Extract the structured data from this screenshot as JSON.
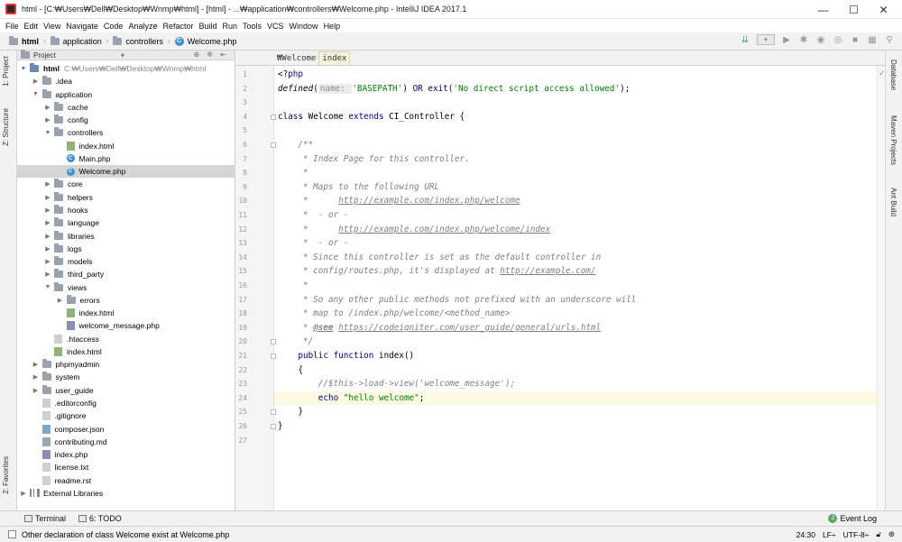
{
  "window": {
    "title": "html - [C:₩Users₩Dell₩Desktop₩Wnmp₩html] - [html] - ...₩application₩controllers₩Welcome.php - IntelliJ IDEA 2017.1",
    "minimize": "—",
    "maximize": "☐",
    "close": "✕"
  },
  "menu": [
    "File",
    "Edit",
    "View",
    "Navigate",
    "Code",
    "Analyze",
    "Refactor",
    "Build",
    "Run",
    "Tools",
    "VCS",
    "Window",
    "Help"
  ],
  "breadcrumb": [
    "html",
    "application",
    "controllers",
    "Welcome.php"
  ],
  "left_tabs": {
    "project": "1: Project",
    "structure": "Z: Structure",
    "favorites": "2: Favorites"
  },
  "right_tabs": {
    "database": "Database",
    "maven": "Maven Projects",
    "ant": "Ant Build"
  },
  "project_panel": {
    "title": "Project",
    "root_path": "C:₩Users₩Dell₩Desktop₩Wnmp₩html"
  },
  "tree": [
    {
      "label": "html",
      "type": "root",
      "depth": 0,
      "open": true
    },
    {
      "label": ".idea",
      "type": "dir",
      "depth": 1,
      "open": false
    },
    {
      "label": "application",
      "type": "dir",
      "depth": 1,
      "open": true
    },
    {
      "label": "cache",
      "type": "dir",
      "depth": 2,
      "open": false
    },
    {
      "label": "config",
      "type": "dir",
      "depth": 2,
      "open": false
    },
    {
      "label": "controllers",
      "type": "dir",
      "depth": 2,
      "open": true
    },
    {
      "label": "index.html",
      "type": "html",
      "depth": 3
    },
    {
      "label": "Main.php",
      "type": "class",
      "depth": 3
    },
    {
      "label": "Welcome.php",
      "type": "class",
      "depth": 3,
      "selected": true
    },
    {
      "label": "core",
      "type": "dir",
      "depth": 2,
      "open": false
    },
    {
      "label": "helpers",
      "type": "dir",
      "depth": 2,
      "open": false
    },
    {
      "label": "hooks",
      "type": "dir",
      "depth": 2,
      "open": false
    },
    {
      "label": "language",
      "type": "dir",
      "depth": 2,
      "open": false
    },
    {
      "label": "libraries",
      "type": "dir",
      "depth": 2,
      "open": false
    },
    {
      "label": "logs",
      "type": "dir",
      "depth": 2,
      "open": false
    },
    {
      "label": "models",
      "type": "dir",
      "depth": 2,
      "open": false
    },
    {
      "label": "third_party",
      "type": "dir",
      "depth": 2,
      "open": false
    },
    {
      "label": "views",
      "type": "dir",
      "depth": 2,
      "open": true
    },
    {
      "label": "errors",
      "type": "dir",
      "depth": 3,
      "open": false
    },
    {
      "label": "index.html",
      "type": "html",
      "depth": 3
    },
    {
      "label": "welcome_message.php",
      "type": "php",
      "depth": 3
    },
    {
      "label": ".htaccess",
      "type": "txt",
      "depth": 2
    },
    {
      "label": "index.html",
      "type": "html",
      "depth": 2
    },
    {
      "label": "phpmyadmin",
      "type": "dir",
      "depth": 1,
      "open": false
    },
    {
      "label": "system",
      "type": "dir",
      "depth": 1,
      "open": false
    },
    {
      "label": "user_guide",
      "type": "dir",
      "depth": 1,
      "open": false
    },
    {
      "label": ".editorconfig",
      "type": "txt",
      "depth": 1
    },
    {
      "label": ".gitignore",
      "type": "txt",
      "depth": 1
    },
    {
      "label": "composer.json",
      "type": "json",
      "depth": 1
    },
    {
      "label": "contributing.md",
      "type": "md",
      "depth": 1
    },
    {
      "label": "index.php",
      "type": "php",
      "depth": 1
    },
    {
      "label": "license.txt",
      "type": "txt",
      "depth": 1
    },
    {
      "label": "readme.rst",
      "type": "txt",
      "depth": 1
    },
    {
      "label": "External Libraries",
      "type": "libs",
      "depth": 0,
      "open": false
    }
  ],
  "editor": {
    "tabs": [
      {
        "label": "₩Welcome",
        "active": false
      },
      {
        "label": "index",
        "active": true
      }
    ],
    "current_line": 24,
    "lines": [
      [
        [
          "kw",
          "<?php"
        ]
      ],
      [
        [
          "fn",
          "defined"
        ],
        [
          "",
          "("
        ],
        [
          "hint",
          "name: "
        ],
        [
          "str",
          "'BASEPATH'"
        ],
        [
          "",
          ") "
        ],
        [
          "kw",
          "OR"
        ],
        [
          "",
          " "
        ],
        [
          "kw",
          "exit"
        ],
        [
          "",
          "("
        ],
        [
          "str",
          "'No direct script access allowed'"
        ],
        [
          "",
          ");"
        ]
      ],
      [],
      [
        [
          "kw",
          "class"
        ],
        [
          "",
          " Welcome "
        ],
        [
          "kw",
          "extends"
        ],
        [
          "",
          " CI_Controller {"
        ]
      ],
      [],
      [
        [
          "cmt",
          "    /**"
        ]
      ],
      [
        [
          "cmt",
          "     * Index Page for this controller."
        ]
      ],
      [
        [
          "cmt",
          "     *"
        ]
      ],
      [
        [
          "cmt",
          "     * Maps to the following URL"
        ]
      ],
      [
        [
          "cmt",
          "     *      "
        ],
        [
          "lnk",
          "http://example.com/index.php/welcome"
        ]
      ],
      [
        [
          "cmt",
          "     *  - or -"
        ]
      ],
      [
        [
          "cmt",
          "     *      "
        ],
        [
          "lnk",
          "http://example.com/index.php/welcome/index"
        ]
      ],
      [
        [
          "cmt",
          "     *  - or -"
        ]
      ],
      [
        [
          "cmt",
          "     * Since this controller is set as the default controller in"
        ]
      ],
      [
        [
          "cmt",
          "     * config/routes.php, it's displayed at "
        ],
        [
          "lnk",
          "http://example.com/"
        ]
      ],
      [
        [
          "cmt",
          "     *"
        ]
      ],
      [
        [
          "cmt",
          "     * So any other public methods not prefixed with an underscore will"
        ]
      ],
      [
        [
          "cmt",
          "     * map to /index.php/welcome/<method_name>"
        ]
      ],
      [
        [
          "cmt",
          "     * "
        ],
        [
          "tag",
          "@see"
        ],
        [
          "cmt",
          " "
        ],
        [
          "lnk",
          "https://codeigniter.com/user_guide/general/urls.html"
        ]
      ],
      [
        [
          "cmt",
          "     */"
        ]
      ],
      [
        [
          "",
          "    "
        ],
        [
          "kw",
          "public"
        ],
        [
          "",
          " "
        ],
        [
          "kw",
          "function"
        ],
        [
          "",
          " index()"
        ]
      ],
      [
        [
          "",
          "    {"
        ]
      ],
      [
        [
          "cmt",
          "        //$this->load->view('welcome_message');"
        ]
      ],
      [
        [
          "",
          "        "
        ],
        [
          "kw",
          "echo"
        ],
        [
          "",
          " "
        ],
        [
          "str",
          "\"hello welcome\""
        ],
        [
          "",
          ";"
        ]
      ],
      [
        [
          "",
          "    }"
        ]
      ],
      [
        [
          "",
          "}"
        ]
      ],
      []
    ]
  },
  "toolwindows": {
    "terminal": "Terminal",
    "todo": "6: TODO",
    "event_log": "Event Log",
    "event_count": "2"
  },
  "status": {
    "message": "Other declaration of class Welcome exist at Welcome.php",
    "position": "24:30",
    "line_sep": "LF÷",
    "encoding": "UTF-8÷"
  },
  "colors": {
    "keyword": "#000080",
    "string": "#008000",
    "comment": "#808080",
    "current_line": "#fcfae3",
    "selection": "#d5d5d5"
  }
}
